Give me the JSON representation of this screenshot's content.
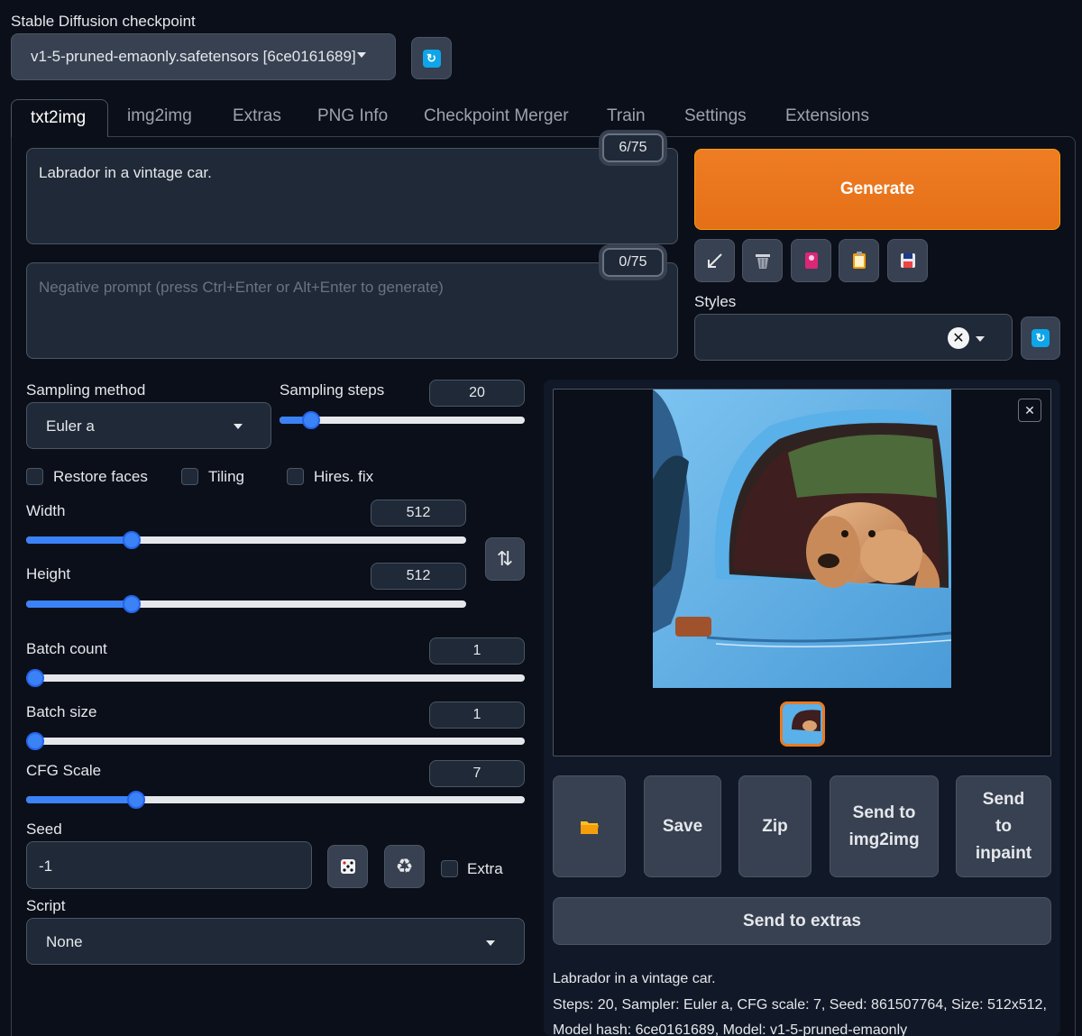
{
  "checkpoint": {
    "label": "Stable Diffusion checkpoint",
    "value": "v1-5-pruned-emaonly.safetensors [6ce0161689]"
  },
  "tabs": [
    "txt2img",
    "img2img",
    "Extras",
    "PNG Info",
    "Checkpoint Merger",
    "Train",
    "Settings",
    "Extensions"
  ],
  "prompt": {
    "value": "Labrador in a vintage car.",
    "token_count": "6/75"
  },
  "negative_prompt": {
    "placeholder": "Negative prompt (press Ctrl+Enter or Alt+Enter to generate)",
    "token_count": "0/75"
  },
  "generate_label": "Generate",
  "styles_label": "Styles",
  "sampling": {
    "method_label": "Sampling method",
    "method_value": "Euler a",
    "steps_label": "Sampling steps",
    "steps_value": "20",
    "steps_fraction": 0.13
  },
  "checkboxes": {
    "restore_faces": "Restore faces",
    "tiling": "Tiling",
    "hires_fix": "Hires. fix"
  },
  "width": {
    "label": "Width",
    "value": "512",
    "fraction": 0.24
  },
  "height": {
    "label": "Height",
    "value": "512",
    "fraction": 0.24
  },
  "batch_count": {
    "label": "Batch count",
    "value": "1",
    "fraction": 0
  },
  "batch_size": {
    "label": "Batch size",
    "value": "1",
    "fraction": 0
  },
  "cfg_scale": {
    "label": "CFG Scale",
    "value": "7",
    "fraction": 0.22
  },
  "seed": {
    "label": "Seed",
    "value": "-1",
    "extra_label": "Extra"
  },
  "script": {
    "label": "Script",
    "value": "None"
  },
  "output_buttons": {
    "save": "Save",
    "zip": "Zip",
    "send_img2img_1": "Send to",
    "send_img2img_2": "img2img",
    "send_inpaint_1": "Send",
    "send_inpaint_2": "to",
    "send_inpaint_3": "inpaint",
    "send_extras": "Send to extras"
  },
  "info": {
    "line1": "Labrador in a vintage car.",
    "line2": "Steps: 20, Sampler: Euler a, CFG scale: 7, Seed: 861507764, Size: 512x512,",
    "line3": "Model hash: 6ce0161689, Model: v1-5-pruned-emaonly"
  },
  "colors": {
    "accent": "#3b82f6",
    "generate": "#ea7a22",
    "background": "#0b0f19"
  }
}
